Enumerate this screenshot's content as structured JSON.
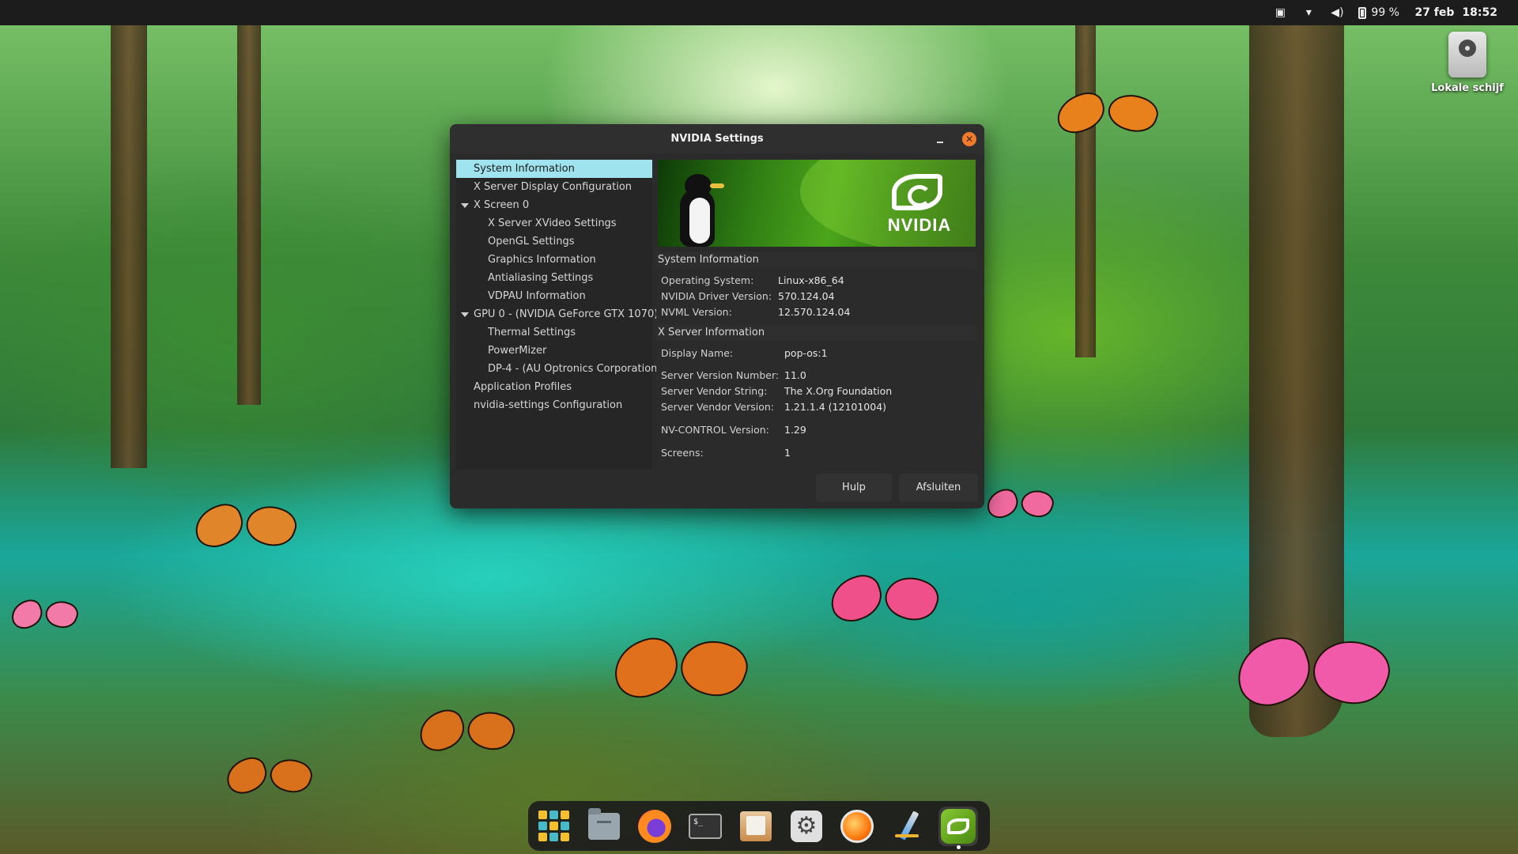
{
  "topbar": {
    "battery": "99 %",
    "date": "27 feb",
    "time": "18:52"
  },
  "desktop": {
    "drive_label": "Lokale schijf"
  },
  "window": {
    "title": "NVIDIA Settings",
    "sidebar": [
      {
        "label": "System Information",
        "selected": true
      },
      {
        "label": "X Server Display Configuration"
      },
      {
        "label": "X Screen 0",
        "expanded": true
      },
      {
        "label": "X Server XVideo Settings"
      },
      {
        "label": "OpenGL Settings"
      },
      {
        "label": "Graphics Information"
      },
      {
        "label": "Antialiasing Settings"
      },
      {
        "label": "VDPAU Information"
      },
      {
        "label": "GPU 0 - (NVIDIA GeForce GTX 1070)",
        "expanded": true
      },
      {
        "label": "Thermal Settings"
      },
      {
        "label": "PowerMizer"
      },
      {
        "label": "DP-4 - (AU Optronics Corporation)"
      },
      {
        "label": "Application Profiles"
      },
      {
        "label": "nvidia-settings Configuration"
      }
    ],
    "banner_logo_text": "NVIDIA",
    "system_info": {
      "header": "System Information",
      "rows": [
        {
          "key": "Operating System:",
          "value": "Linux-x86_64"
        },
        {
          "key": "NVIDIA Driver Version:",
          "value": "570.124.04"
        },
        {
          "key": "NVML Version:",
          "value": "12.570.124.04"
        }
      ]
    },
    "xserver_info": {
      "header": "X Server Information",
      "rows": [
        {
          "key": "Display Name:",
          "value": "pop-os:1"
        },
        {
          "key": "Server Version Number:",
          "value": "11.0"
        },
        {
          "key": "Server Vendor String:",
          "value": "The X.Org Foundation"
        },
        {
          "key": "Server Vendor Version:",
          "value": "1.21.1.4 (12101004)"
        },
        {
          "key": "NV-CONTROL Version:",
          "value": "1.29"
        },
        {
          "key": "Screens:",
          "value": "1"
        }
      ]
    },
    "buttons": {
      "help": "Hulp",
      "quit": "Afsluiten"
    }
  },
  "dock": {
    "items": [
      "apps-grid-icon",
      "files-icon",
      "firefox-icon",
      "terminal-icon",
      "text-editor-icon",
      "settings-icon",
      "app-orb-icon",
      "drawing-pen-icon",
      "nvidia-settings-icon"
    ],
    "terminal_glyph": "$_"
  },
  "colors": {
    "selection": "#9fe3ee",
    "close_button": "#f07a2a",
    "nvidia_green": "#76b900"
  }
}
